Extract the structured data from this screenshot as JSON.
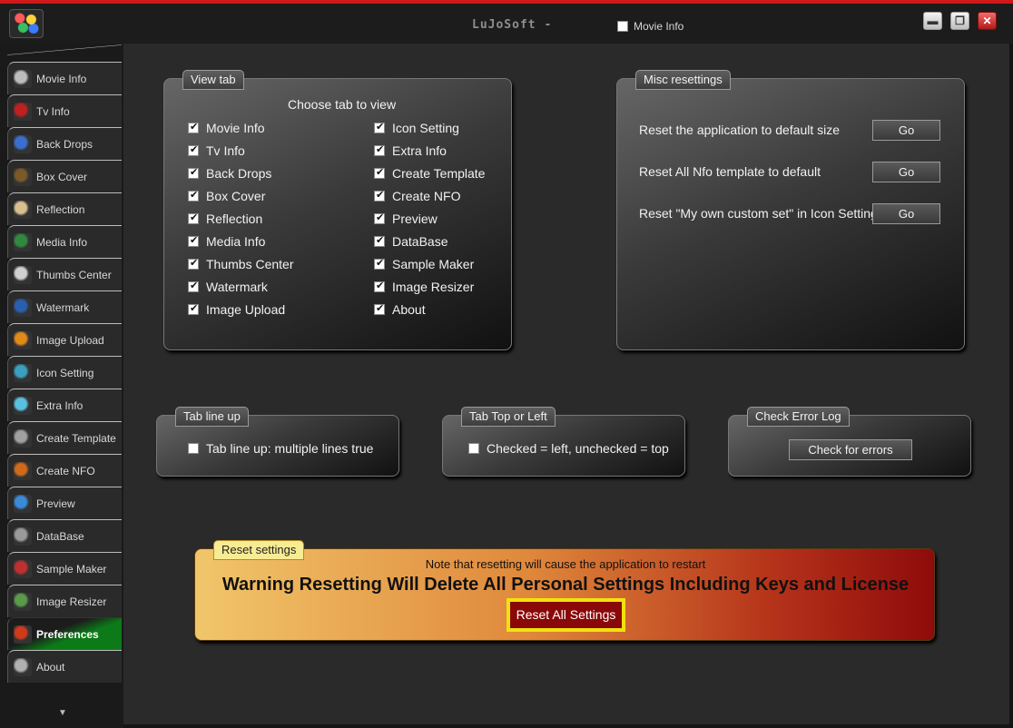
{
  "titlebar": {
    "title": "LuJoSoft -",
    "checkbox_label": "Movie Info",
    "checkbox_checked": false,
    "minimize_icon": "minimize-icon",
    "maximize_icon": "maximize-icon",
    "close_icon": "close-icon"
  },
  "sidebar": {
    "items": [
      {
        "label": "Movie Info",
        "icon": "film-reel-icon",
        "color": "#bdbdbd"
      },
      {
        "label": "Tv Info",
        "icon": "tv-icon",
        "color": "#c02020"
      },
      {
        "label": "Back Drops",
        "icon": "backdrop-icon",
        "color": "#3a6fd0"
      },
      {
        "label": "Box Cover",
        "icon": "box-cover-icon",
        "color": "#7a5a2a"
      },
      {
        "label": "Reflection",
        "icon": "reflection-icon",
        "color": "#d8c090"
      },
      {
        "label": "Media Info",
        "icon": "media-info-icon",
        "color": "#2f8a3f"
      },
      {
        "label": "Thumbs Center",
        "icon": "thumbs-icon",
        "color": "#d0d0d0"
      },
      {
        "label": "Watermark",
        "icon": "watermark-icon",
        "color": "#2a5fb0"
      },
      {
        "label": "Image Upload",
        "icon": "upload-icon",
        "color": "#e08a1a"
      },
      {
        "label": "Icon Setting",
        "icon": "gear-icon",
        "color": "#3aa0c0"
      },
      {
        "label": "Extra Info",
        "icon": "extra-info-icon",
        "color": "#5ac0e0"
      },
      {
        "label": "Create Template",
        "icon": "template-icon",
        "color": "#a0a0a0"
      },
      {
        "label": "Create NFO",
        "icon": "nfo-icon",
        "color": "#d06a1a"
      },
      {
        "label": "Preview",
        "icon": "eye-icon",
        "color": "#3a8ad8"
      },
      {
        "label": "DataBase",
        "icon": "database-icon",
        "color": "#9a9a9a"
      },
      {
        "label": "Sample Maker",
        "icon": "clapperboard-icon",
        "color": "#c03030"
      },
      {
        "label": "Image Resizer",
        "icon": "resize-icon",
        "color": "#5a9a4a"
      },
      {
        "label": "Preferences",
        "icon": "wrench-icon",
        "color": "#d03a1a"
      },
      {
        "label": "About",
        "icon": "user-icon",
        "color": "#b0b0b0"
      }
    ],
    "active_index": 17,
    "scroll_icon": "arrow-down-icon"
  },
  "view_tab": {
    "title": "View tab",
    "heading": "Choose tab to view",
    "left": [
      {
        "label": "Movie Info",
        "checked": true
      },
      {
        "label": "Tv Info",
        "checked": true
      },
      {
        "label": "Back Drops",
        "checked": true
      },
      {
        "label": "Box Cover",
        "checked": true
      },
      {
        "label": "Reflection",
        "checked": true
      },
      {
        "label": "Media Info",
        "checked": true
      },
      {
        "label": "Thumbs Center",
        "checked": true
      },
      {
        "label": "Watermark",
        "checked": true
      },
      {
        "label": "Image Upload",
        "checked": true
      }
    ],
    "right": [
      {
        "label": "Icon Setting",
        "checked": true
      },
      {
        "label": "Extra Info",
        "checked": true
      },
      {
        "label": "Create Template",
        "checked": true
      },
      {
        "label": "Create NFO",
        "checked": true
      },
      {
        "label": "Preview",
        "checked": true
      },
      {
        "label": "DataBase",
        "checked": true
      },
      {
        "label": "Sample Maker",
        "checked": true
      },
      {
        "label": "Image Resizer",
        "checked": true
      },
      {
        "label": "About",
        "checked": true
      }
    ]
  },
  "misc": {
    "title": "Misc resettings",
    "rows": [
      {
        "label": "Reset the application to default size",
        "button": "Go"
      },
      {
        "label": "Reset All Nfo template to default",
        "button": "Go"
      },
      {
        "label": "Reset \"My own custom set\" in Icon Setting",
        "button": "Go"
      }
    ]
  },
  "tab_line_up": {
    "title": "Tab line up",
    "label": "Tab line up: multiple lines true",
    "checked": false
  },
  "tab_top_left": {
    "title": "Tab Top or Left",
    "label": "Checked = left, unchecked = top",
    "checked": false
  },
  "error_log": {
    "title": "Check Error Log",
    "button": "Check for errors"
  },
  "reset": {
    "title": "Reset settings",
    "note": "Note that resetting will cause the application to restart",
    "warning": "Warning Resetting Will Delete All Personal Settings Including Keys and License",
    "button": "Reset All Settings"
  }
}
